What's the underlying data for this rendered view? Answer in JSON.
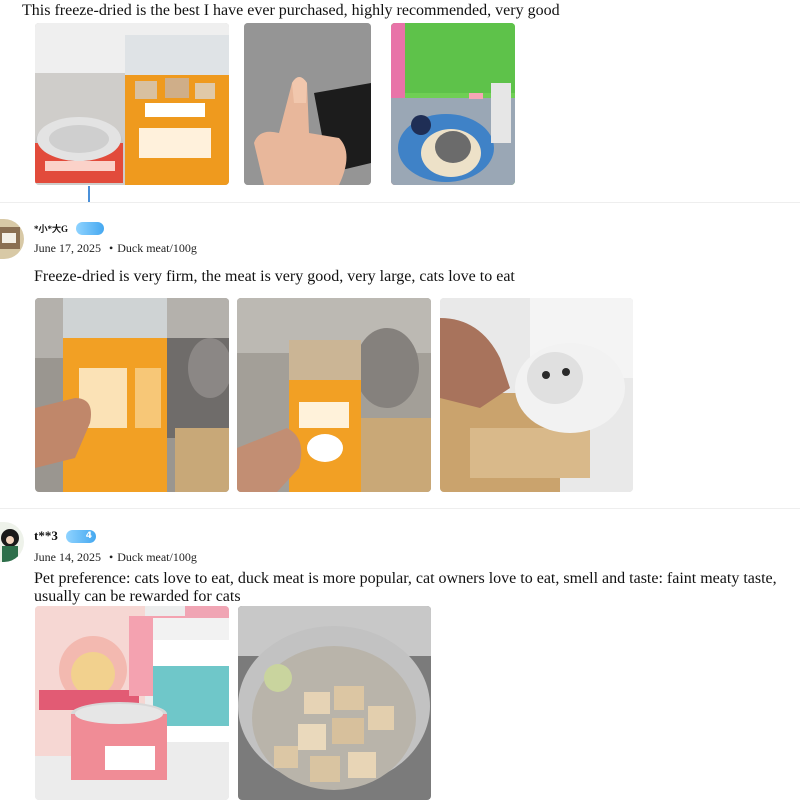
{
  "reviews": [
    {
      "text": "This freeze-dried is the best I have ever purchased, highly recommended, very good",
      "photos": [
        {
          "name": "jar-and-can-photo"
        },
        {
          "name": "thumbs-up-photo"
        },
        {
          "name": "cat-in-bed-photo"
        }
      ]
    },
    {
      "username": "*小*大G",
      "badge": "",
      "date": "June 17, 2025",
      "variant": "Duck meat/100g",
      "text": "Freeze-dried is very firm, the meat is very good, very large, cats love to eat",
      "photos": [
        {
          "name": "jar-side-photo"
        },
        {
          "name": "jar-front-photo"
        },
        {
          "name": "cat-eating-photo"
        }
      ]
    },
    {
      "username": "t**3",
      "badge": "4",
      "date": "June 14, 2025",
      "variant": "Duck meat/100g",
      "text": "Pet preference: cats love to eat, duck meat is more popular, cat owners love to eat, smell and taste: faint meaty taste, usually can be rewarded for cats",
      "photos": [
        {
          "name": "products-group-photo"
        },
        {
          "name": "open-jar-photo"
        }
      ]
    }
  ],
  "ui": {
    "bullet": "•"
  },
  "colors": {
    "badge": "#45a8f0",
    "divider": "#eeeeee"
  }
}
